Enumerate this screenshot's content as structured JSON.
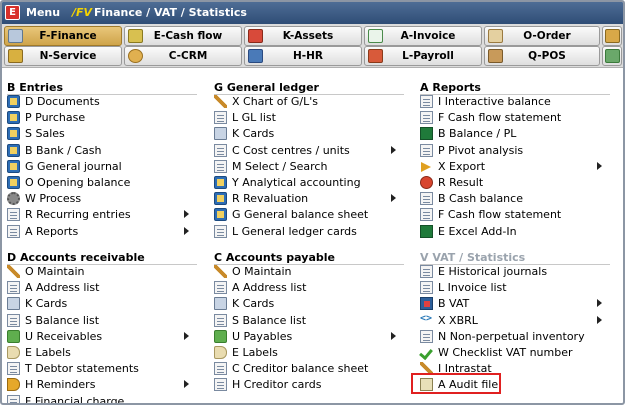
{
  "title_bar": {
    "logo": "E",
    "menu_label": "Menu",
    "crumb_prefix": "/FV",
    "crumb": "Finance / VAT / Statistics"
  },
  "tabs_row1": [
    {
      "label": "F-Finance",
      "icon": "finance-icon",
      "active": true
    },
    {
      "label": "E-Cash flow",
      "icon": "cash-flow-icon"
    },
    {
      "label": "K-Assets",
      "icon": "assets-icon"
    },
    {
      "label": "A-Invoice",
      "icon": "invoice-icon"
    },
    {
      "label": "O-Order",
      "icon": "order-icon"
    }
  ],
  "tabs_row2": [
    {
      "label": "N-Service",
      "icon": "service-icon"
    },
    {
      "label": "C-CRM",
      "icon": "crm-icon"
    },
    {
      "label": "H-HR",
      "icon": "hr-icon"
    },
    {
      "label": "L-Payroll",
      "icon": "payroll-icon"
    },
    {
      "label": "Q-POS",
      "icon": "pos-icon"
    }
  ],
  "sections": {
    "entries": {
      "title": "B Entries",
      "items": [
        {
          "label": "D Documents",
          "icon": "book-icon"
        },
        {
          "label": "P Purchase",
          "icon": "book-icon"
        },
        {
          "label": "S Sales",
          "icon": "book-icon"
        },
        {
          "label": "B Bank / Cash",
          "icon": "book-icon"
        },
        {
          "label": "G General journal",
          "icon": "book-icon"
        },
        {
          "label": "O Opening balance",
          "icon": "book-icon"
        },
        {
          "label": "W Process",
          "icon": "gear-icon"
        },
        {
          "label": "R Recurring entries",
          "icon": "doc-icon",
          "submenu": true
        },
        {
          "label": "A Reports",
          "icon": "doc-icon",
          "submenu": true
        }
      ]
    },
    "receivable": {
      "title": "D Accounts receivable",
      "items": [
        {
          "label": "O Maintain",
          "icon": "wrench-icon"
        },
        {
          "label": "A Address list",
          "icon": "doc-icon"
        },
        {
          "label": "K Cards",
          "icon": "card-icon"
        },
        {
          "label": "S Balance list",
          "icon": "doc-icon"
        },
        {
          "label": "U Receivables",
          "icon": "money-icon",
          "submenu": true
        },
        {
          "label": "E Labels",
          "icon": "tag-icon"
        },
        {
          "label": "T Debtor statements",
          "icon": "doc-icon"
        },
        {
          "label": "H Reminders",
          "icon": "megaphone-icon",
          "submenu": true
        },
        {
          "label": "F Financial charge",
          "icon": "doc-icon"
        }
      ]
    },
    "ledger": {
      "title": "G General ledger",
      "items": [
        {
          "label": "X Chart of G/L's",
          "icon": "wrench-icon"
        },
        {
          "label": "L GL list",
          "icon": "doc-icon"
        },
        {
          "label": "K Cards",
          "icon": "card-icon"
        },
        {
          "label": "C Cost centres / units",
          "icon": "doc-icon",
          "submenu": true
        },
        {
          "label": "M Select / Search",
          "icon": "doc-icon"
        },
        {
          "label": "Y Analytical accounting",
          "icon": "book-icon"
        },
        {
          "label": "R Revaluation",
          "icon": "book-icon",
          "submenu": true
        },
        {
          "label": "G General balance sheet",
          "icon": "book-icon"
        },
        {
          "label": "L General ledger cards",
          "icon": "doc-icon"
        }
      ]
    },
    "payable": {
      "title": "C Accounts payable",
      "items": [
        {
          "label": "O Maintain",
          "icon": "wrench-icon"
        },
        {
          "label": "A Address list",
          "icon": "doc-icon"
        },
        {
          "label": "K Cards",
          "icon": "card-icon"
        },
        {
          "label": "S Balance list",
          "icon": "doc-icon"
        },
        {
          "label": "U Payables",
          "icon": "money-icon",
          "submenu": true
        },
        {
          "label": "E Labels",
          "icon": "tag-icon"
        },
        {
          "label": "C Creditor balance sheet",
          "icon": "doc-icon"
        },
        {
          "label": "H Creditor cards",
          "icon": "doc-icon"
        }
      ]
    },
    "reports": {
      "title": "A Reports",
      "items": [
        {
          "label": "I Interactive balance",
          "icon": "doc-icon"
        },
        {
          "label": "F Cash flow statement",
          "icon": "doc-icon"
        },
        {
          "label": "B Balance / PL",
          "icon": "excel-icon"
        },
        {
          "label": "P Pivot analysis",
          "icon": "doc-icon"
        },
        {
          "label": "X Export",
          "icon": "export-icon",
          "submenu": true
        },
        {
          "label": "R Result",
          "icon": "result-icon"
        },
        {
          "label": "B Cash balance",
          "icon": "doc-icon"
        },
        {
          "label": "F Cash flow statement",
          "icon": "doc-icon"
        },
        {
          "label": "E Excel Add-In",
          "icon": "excel-icon"
        }
      ]
    },
    "vat": {
      "title": "V VAT / Statistics",
      "items": [
        {
          "label": "E Historical journals",
          "icon": "doc-icon"
        },
        {
          "label": "L Invoice list",
          "icon": "doc-icon"
        },
        {
          "label": "B VAT",
          "icon": "vat-icon",
          "submenu": true
        },
        {
          "label": "X XBRL",
          "icon": "xml-icon",
          "submenu": true
        },
        {
          "label": "N Non-perpetual inventory",
          "icon": "doc-icon"
        },
        {
          "label": "W Checklist VAT number",
          "icon": "check-icon"
        },
        {
          "label": "I Intrastat",
          "icon": "wrench-icon"
        },
        {
          "label": "A Audit file",
          "icon": "file-icon"
        }
      ]
    }
  }
}
